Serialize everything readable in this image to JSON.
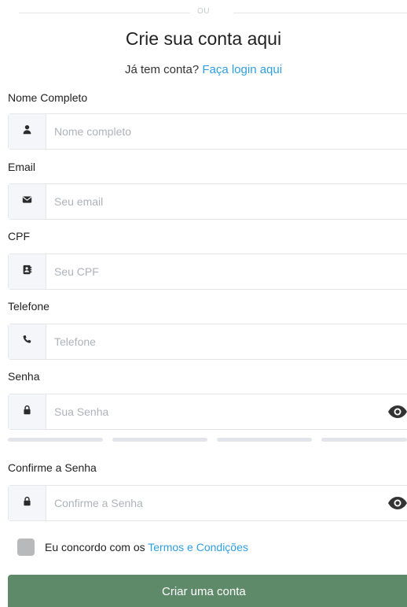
{
  "divider": {
    "text": "OU"
  },
  "header": {
    "title": "Crie sua conta aqui",
    "subtitle_prefix": "Já tem conta?",
    "login_link": "Faça login aqui"
  },
  "form": {
    "fields": [
      {
        "label": "Nome Completo",
        "placeholder": "Nome completo",
        "icon": "user-icon",
        "value": ""
      },
      {
        "label": "Email",
        "placeholder": "Seu email",
        "icon": "envelope-icon",
        "value": ""
      },
      {
        "label": "CPF",
        "placeholder": "Seu CPF",
        "icon": "address-book-icon",
        "value": ""
      },
      {
        "label": "Telefone",
        "placeholder": "Telefone",
        "icon": "phone-icon",
        "value": ""
      },
      {
        "label": "Senha",
        "placeholder": "Sua Senha",
        "icon": "lock-icon",
        "value": "",
        "toggle_icon": "eye-icon"
      },
      {
        "label": "Confirme a Senha",
        "placeholder": "Confirme a Senha",
        "icon": "lock-icon",
        "value": "",
        "toggle_icon": "eye-icon"
      }
    ],
    "password_strength": {
      "segments": 4,
      "filled": 0
    },
    "terms": {
      "checked": false,
      "prefix": "Eu concordo com os",
      "link": "Termos e Condições"
    },
    "submit_label": "Criar uma conta"
  },
  "colors": {
    "accent_link": "#2f9fe0",
    "submit_bg": "#5e8a6a",
    "addon_bg": "#f4f6f9",
    "border": "#e3e6ea",
    "checkbox": "#b8b9bb"
  }
}
